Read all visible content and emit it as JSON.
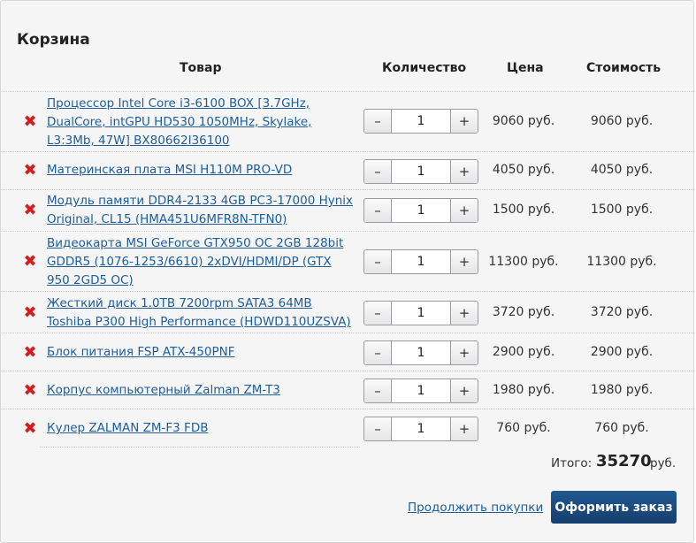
{
  "title": "Корзина",
  "headers": {
    "product": "Товар",
    "qty": "Количество",
    "price": "Цена",
    "cost": "Стоимость"
  },
  "qty_controls": {
    "minus": "–",
    "plus": "+"
  },
  "remove_glyph": "✖",
  "items": [
    {
      "name": "Процессор Intel Core i3-6100 BOX [3.7GHz, DualCore, intGPU HD530 1050MHz, Skylake, L3:3Mb, 47W] BX80662I36100",
      "qty": "1",
      "price": "9060 руб.",
      "cost": "9060 руб."
    },
    {
      "name": "Материнская плата MSI H110M PRO-VD",
      "qty": "1",
      "price": "4050 руб.",
      "cost": "4050 руб."
    },
    {
      "name": "Модуль памяти DDR4-2133 4GB PC3-17000 Hynix Original, CL15 (HMA451U6MFR8N-TFN0)",
      "qty": "1",
      "price": "1500 руб.",
      "cost": "1500 руб."
    },
    {
      "name": "Видеокарта MSI GeForce GTX950 OC 2GB 128bit GDDR5 (1076-1253/6610) 2xDVI/HDMI/DP (GTX 950 2GD5 OC)",
      "qty": "1",
      "price": "11300 руб.",
      "cost": "11300 руб."
    },
    {
      "name": "Жесткий диск 1.0TB 7200rpm SATA3 64MB Toshiba P300 High Performance (HDWD110UZSVA)",
      "qty": "1",
      "price": "3720 руб.",
      "cost": "3720 руб."
    },
    {
      "name": "Блок питания FSP ATX-450PNF",
      "qty": "1",
      "price": "2900 руб.",
      "cost": "2900 руб."
    },
    {
      "name": "Корпус компьютерный Zalman ZM-T3",
      "qty": "1",
      "price": "1980 руб.",
      "cost": "1980 руб."
    },
    {
      "name": "Кулер ZALMAN ZM-F3 FDB",
      "qty": "1",
      "price": "760 руб.",
      "cost": "760 руб."
    }
  ],
  "total": {
    "label": "Итого:",
    "value": "35270",
    "currency": "руб."
  },
  "actions": {
    "continue": "Продолжить покупки",
    "checkout": "Оформить заказ"
  },
  "colors": {
    "link": "#1d5e9b",
    "remove": "#d21e1e",
    "checkout_bg": "#1a4a7e"
  }
}
